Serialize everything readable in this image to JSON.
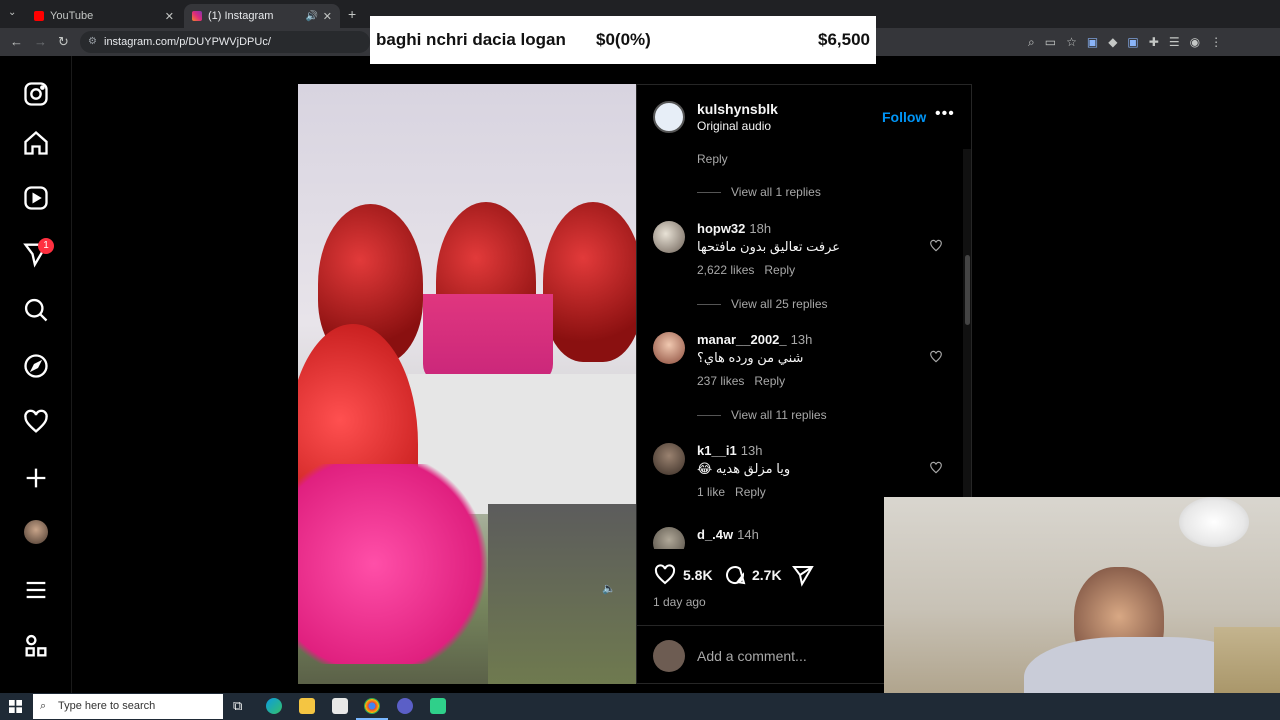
{
  "browser": {
    "tabs": [
      {
        "title": "YouTube",
        "active": false
      },
      {
        "title": "(1) Instagram",
        "active": true
      }
    ],
    "url": "instagram.com/p/DUYPWVjDPUc/"
  },
  "overlay_banner": {
    "text": "baghi nchri dacia logan",
    "change": "$0(0%)",
    "amount": "$6,500"
  },
  "sidebar": {
    "notification_badge": "1",
    "icons": [
      "instagram-logo-icon",
      "home-icon",
      "reels-icon",
      "messages-icon",
      "search-icon",
      "explore-icon",
      "heart-icon",
      "create-icon",
      "profile-avatar",
      "menu-icon",
      "more-apps-icon"
    ]
  },
  "post": {
    "username": "kulshynsblk",
    "audio": "Original audio",
    "follow_label": "Follow",
    "likes": "5.8K",
    "comments_count": "2.7K",
    "posted": "1 day ago",
    "add_comment_placeholder": "Add a comment..."
  },
  "comments": {
    "top_reply": "Reply",
    "top_view_replies": "View all 1 replies",
    "items": [
      {
        "user": "hopw32",
        "time": "18h",
        "text": "عرفت تعاليق بدون مافتحها",
        "likes": "2,622 likes",
        "reply": "Reply",
        "view_replies": "View all 25 replies"
      },
      {
        "user": "manar__2002_",
        "time": "13h",
        "text": "شني من ورده هاي؟",
        "likes": "237 likes",
        "reply": "Reply",
        "view_replies": "View all 11 replies"
      },
      {
        "user": "k1__i1",
        "time": "13h",
        "text": "😂 ويا مزلق هديه",
        "likes": "1 like",
        "reply": "Reply",
        "view_replies": ""
      },
      {
        "user": "d_.4w",
        "time": "14h",
        "text": "",
        "likes": "",
        "reply": "",
        "view_replies": ""
      }
    ]
  },
  "taskbar": {
    "search_placeholder": "Type here to search"
  }
}
